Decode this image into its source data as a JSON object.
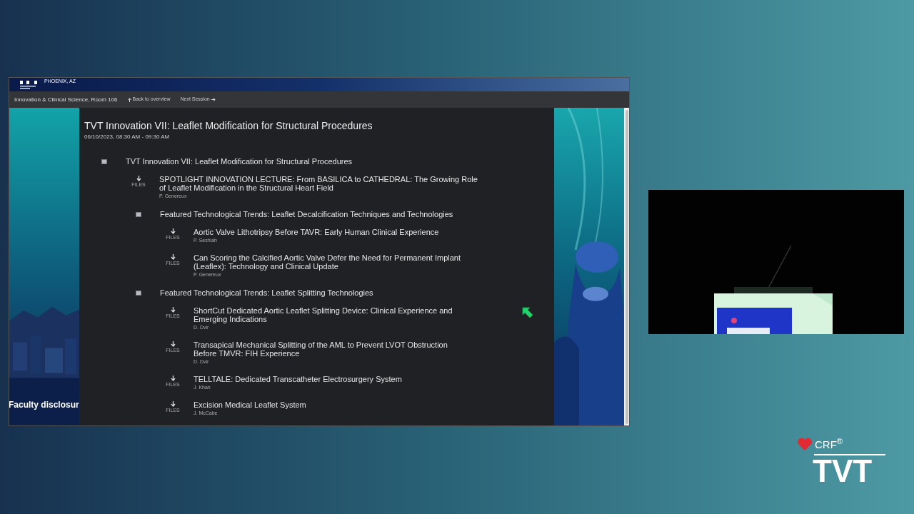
{
  "browser": {
    "banner": {
      "location": "PHOENIX, AZ"
    },
    "nav": {
      "room": "Innovation & Clinical Science, Room 106",
      "back": "Back to overview",
      "next": "Next Session"
    },
    "side_banner": {
      "text": "Faculty disclosur"
    },
    "session": {
      "title": "TVT Innovation VII: Leaflet Modification for Structural Procedures",
      "time": "06/10/2023, 08:30 AM - 09:30 AM"
    },
    "program": [
      {
        "kind": "group",
        "title": "TVT Innovation VII: Leaflet Modification for Structural Procedures",
        "children": [
          {
            "kind": "talk",
            "title": "SPOTLIGHT INNOVATION LECTURE: From BASILICA to CATHEDRAL: The Growing Role of Leaflet Modification in the Structural Heart Field",
            "speaker": "P. Genereux",
            "files": "FILES"
          },
          {
            "kind": "group",
            "title": "Featured Technological Trends: Leaflet Decalcification Techniques and Technologies",
            "children": [
              {
                "kind": "talk",
                "title": "Aortic Valve Lithotripsy Before TAVR: Early Human Clinical Experience",
                "speaker": "P. Seshiah",
                "files": "FILES"
              },
              {
                "kind": "talk",
                "title": "Can Scoring the Calcified Aortic Valve Defer the Need for Permanent Implant (Leaflex): Technology and Clinical Update",
                "speaker": "P. Genereux",
                "files": "FILES"
              }
            ]
          },
          {
            "kind": "group",
            "title": "Featured Technological Trends: Leaflet Splitting Technologies",
            "children": [
              {
                "kind": "talk",
                "title": "ShortCut Dedicated Aortic Leaflet Splitting Device: Clinical Experience and Emerging Indications",
                "speaker": "D. Dvir",
                "files": "FILES"
              },
              {
                "kind": "talk",
                "title": "Transapical Mechanical Splitting of the AML to Prevent LVOT Obstruction Before TMVR: FIH Experience",
                "speaker": "D. Dvir",
                "files": "FILES"
              },
              {
                "kind": "talk",
                "title": "TELLTALE: Dedicated Transcatheter Electrosurgery System",
                "speaker": "J. Khan",
                "files": "FILES"
              },
              {
                "kind": "talk",
                "title": "Excision Medical Leaflet System",
                "speaker": "J. McCabe",
                "files": "FILES"
              }
            ]
          }
        ]
      }
    ]
  },
  "logo": {
    "brand": "CRF$^{®}$",
    "event": "TVT"
  }
}
